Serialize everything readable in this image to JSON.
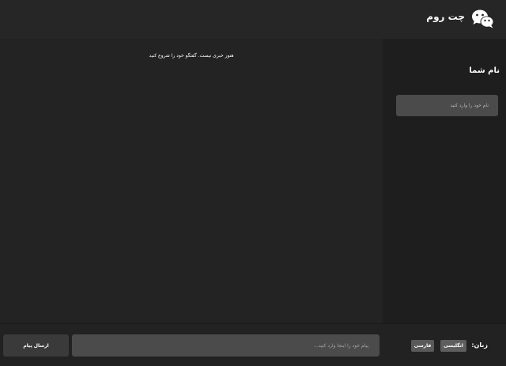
{
  "header": {
    "title": "چت روم",
    "logo_icon": "wechat-icon"
  },
  "sidebar": {
    "title": "نام شما",
    "name_placeholder": "نام خود را وارد کنید"
  },
  "chat": {
    "empty_message": "هنوز خبری نیست. گفتگو خود را شروع کنید"
  },
  "footer": {
    "message_placeholder": "پیام خود را اینجا وارد کنید...",
    "send_label": "ارسال پیام",
    "language_label": "زبان:",
    "languages": [
      "انگلیسی",
      "فارسی"
    ]
  },
  "colors": {
    "background": "#232323",
    "sidebar": "#1e1e1e",
    "input": "#4b4b4b",
    "button": "#3a3a3a",
    "text": "#ffffff"
  }
}
